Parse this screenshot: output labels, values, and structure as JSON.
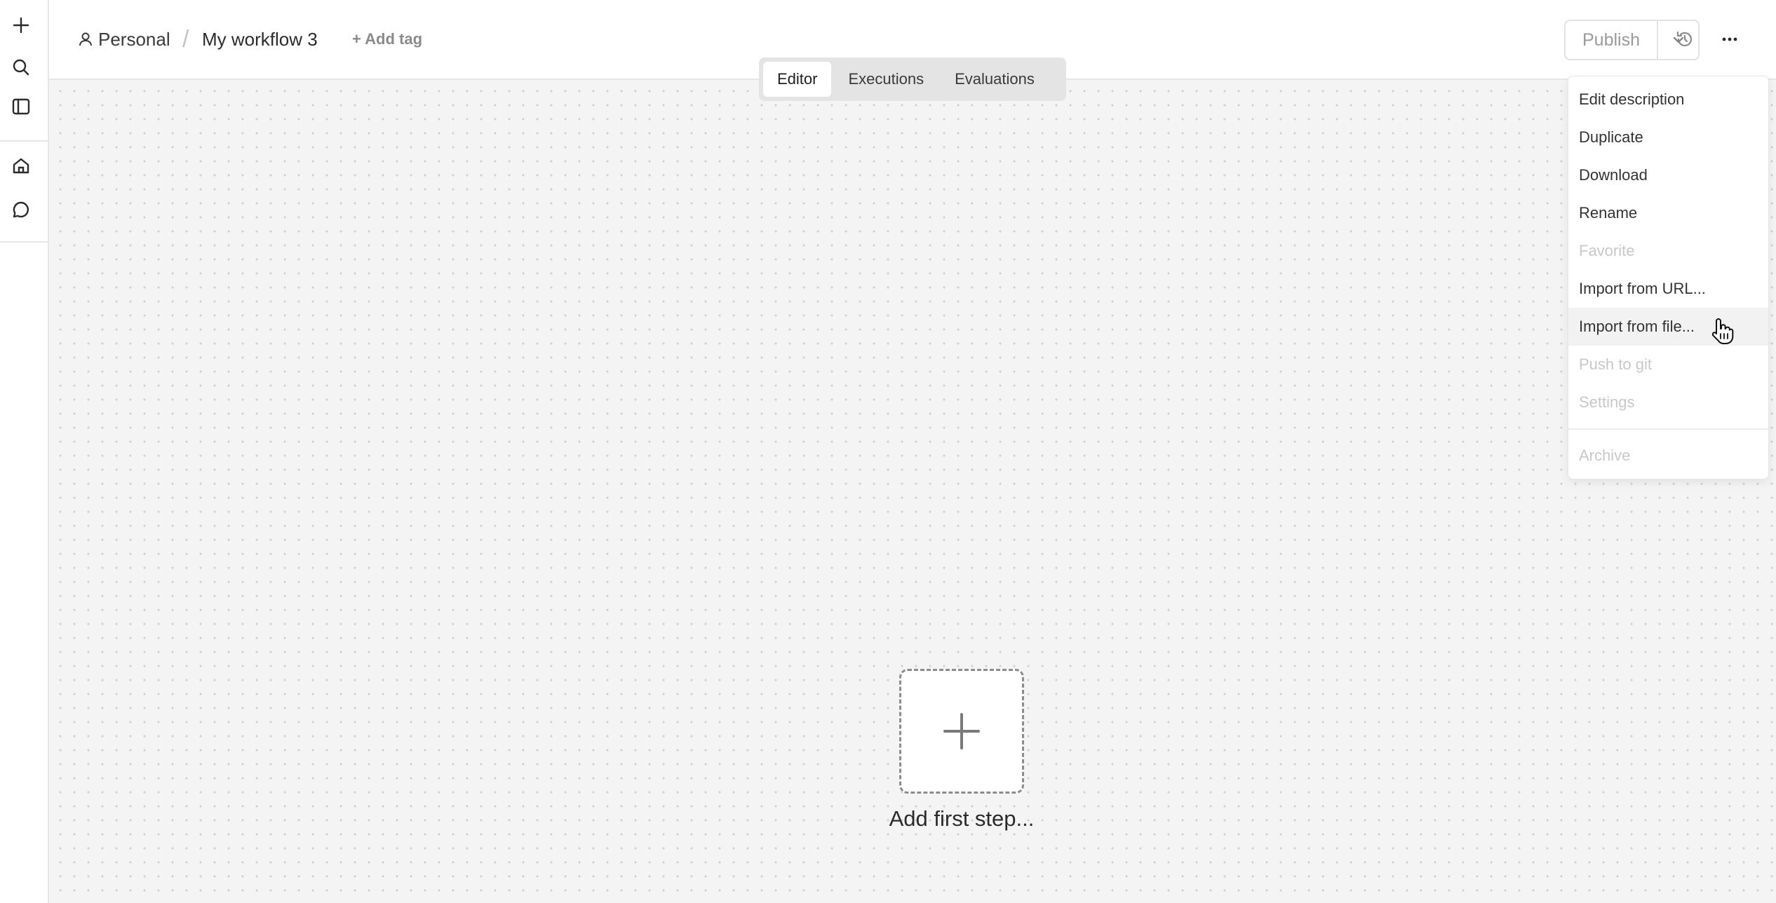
{
  "header": {
    "project_label": "Personal",
    "separator": "/",
    "workflow_name": "My workflow 3",
    "add_tag_label": "+ Add tag",
    "publish_label": "Publish"
  },
  "tabs": [
    {
      "label": "Editor",
      "active": true
    },
    {
      "label": "Executions",
      "active": false
    },
    {
      "label": "Evaluations",
      "active": false
    }
  ],
  "canvas": {
    "add_first_step_label": "Add first step..."
  },
  "menu": {
    "items": [
      {
        "label": "Edit description",
        "enabled": true
      },
      {
        "label": "Duplicate",
        "enabled": true
      },
      {
        "label": "Download",
        "enabled": true
      },
      {
        "label": "Rename",
        "enabled": true
      },
      {
        "label": "Favorite",
        "enabled": false
      },
      {
        "label": "Import from URL...",
        "enabled": true
      },
      {
        "label": "Import from file...",
        "enabled": true,
        "hovered": true
      },
      {
        "label": "Push to git",
        "enabled": false
      },
      {
        "label": "Settings",
        "enabled": false
      },
      {
        "label": "Archive",
        "enabled": false
      }
    ]
  },
  "rail_icons": [
    "plus-icon",
    "search-icon",
    "sidebar-toggle-icon",
    "home-icon",
    "chat-icon"
  ],
  "colors": {
    "canvas_bg": "#f4f4f4",
    "disabled_text": "#c8c8c8",
    "border": "#e6e6e6"
  }
}
